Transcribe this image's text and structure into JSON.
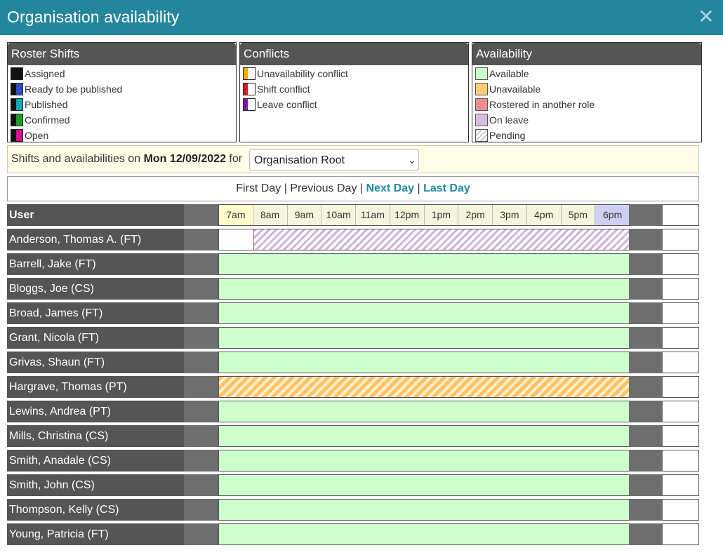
{
  "window": {
    "title": "Organisation availability",
    "close_icon": "close-icon"
  },
  "legend": {
    "roster": {
      "heading": "Roster Shifts",
      "items": [
        {
          "label": "Assigned",
          "color": "#111111"
        },
        {
          "label": "Ready to be published",
          "color": "#2f4fc2"
        },
        {
          "label": "Published",
          "color": "#0fa6b8"
        },
        {
          "label": "Confirmed",
          "color": "#1c9a2a"
        },
        {
          "label": "Open",
          "color": "#d4128a"
        }
      ]
    },
    "conflicts": {
      "heading": "Conflicts",
      "items": [
        {
          "label": "Unavailability conflict",
          "color": "#f2a900"
        },
        {
          "label": "Shift conflict",
          "color": "#d91c1c"
        },
        {
          "label": "Leave conflict",
          "color": "#7a1a9e"
        }
      ]
    },
    "availability": {
      "heading": "Availability",
      "items": [
        {
          "label": "Available",
          "color": "#ccffcc"
        },
        {
          "label": "Unavailable",
          "color": "#ffcc77"
        },
        {
          "label": "Rostered in another role",
          "color": "#f28b8b"
        },
        {
          "label": "On leave",
          "color": "#d6bfdc"
        },
        {
          "label": "Pending",
          "color": "#d9d9d9"
        }
      ]
    }
  },
  "info": {
    "prefix": "Shifts and availabilities on",
    "date": "Mon 12/09/2022",
    "for_label": "for",
    "organisation_selected": "Organisation Root"
  },
  "nav": {
    "first_day": "First Day",
    "separator": "|",
    "previous_day": "Previous Day",
    "next_day": "Next Day",
    "last_day": "Last Day"
  },
  "grid": {
    "user_header": "User",
    "hours": [
      "7am",
      "8am",
      "9am",
      "10am",
      "11am",
      "12pm",
      "1pm",
      "2pm",
      "3pm",
      "4pm",
      "5pm",
      "6pm"
    ],
    "users": [
      {
        "name": "Anderson, Thomas A. (FT)",
        "status": "On leave",
        "start_hour_index": 1,
        "end_hour_index": 12
      },
      {
        "name": "Barrell, Jake (FT)",
        "status": "Available",
        "start_hour_index": 0,
        "end_hour_index": 12
      },
      {
        "name": "Bloggs, Joe (CS)",
        "status": "Available",
        "start_hour_index": 0,
        "end_hour_index": 12
      },
      {
        "name": "Broad, James (FT)",
        "status": "Available",
        "start_hour_index": 0,
        "end_hour_index": 12
      },
      {
        "name": "Grant, Nicola (FT)",
        "status": "Available",
        "start_hour_index": 0,
        "end_hour_index": 12
      },
      {
        "name": "Grivas, Shaun (FT)",
        "status": "Available",
        "start_hour_index": 0,
        "end_hour_index": 12
      },
      {
        "name": "Hargrave, Thomas (PT)",
        "status": "Unavailable",
        "start_hour_index": 0,
        "end_hour_index": 12
      },
      {
        "name": "Lewins, Andrea (PT)",
        "status": "Available",
        "start_hour_index": 0,
        "end_hour_index": 12
      },
      {
        "name": "Mills, Christina (CS)",
        "status": "Available",
        "start_hour_index": 0,
        "end_hour_index": 12
      },
      {
        "name": "Smith, Anadale (CS)",
        "status": "Available",
        "start_hour_index": 0,
        "end_hour_index": 12
      },
      {
        "name": "Smith, John (CS)",
        "status": "Available",
        "start_hour_index": 0,
        "end_hour_index": 12
      },
      {
        "name": "Thompson, Kelly (CS)",
        "status": "Available",
        "start_hour_index": 0,
        "end_hour_index": 12
      },
      {
        "name": "Young, Patricia (FT)",
        "status": "Available",
        "start_hour_index": 0,
        "end_hour_index": 12
      }
    ]
  }
}
